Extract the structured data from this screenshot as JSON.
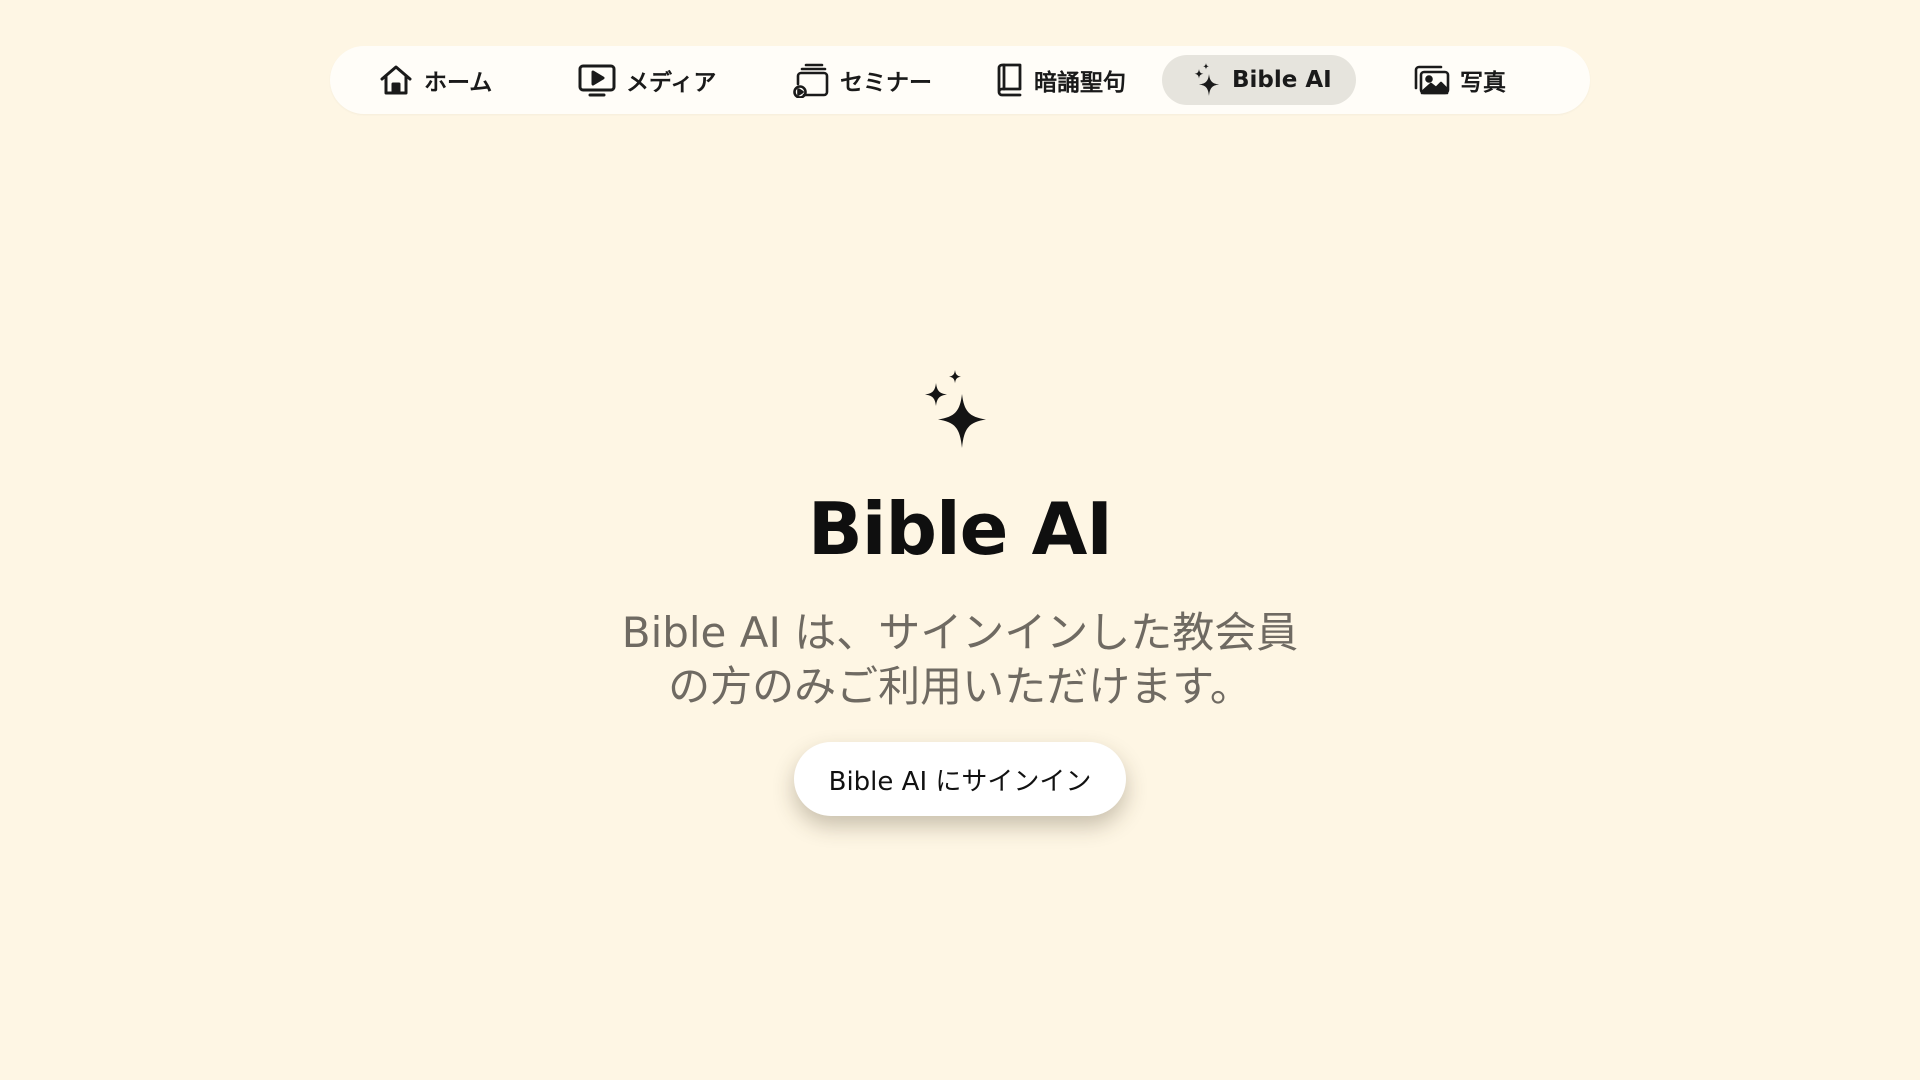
{
  "nav": {
    "items": [
      {
        "label": "ホーム",
        "icon": "home-icon"
      },
      {
        "label": "メディア",
        "icon": "play-screen-icon"
      },
      {
        "label": "セミナー",
        "icon": "seminar-stack-icon"
      },
      {
        "label": "暗誦聖句",
        "icon": "book-icon"
      },
      {
        "label": "Bible AI",
        "icon": "sparkles-icon",
        "active": true
      },
      {
        "label": "写真",
        "icon": "photos-icon"
      }
    ]
  },
  "hero": {
    "icon": "sparkles-icon",
    "title": "Bible AI",
    "description_line1": "Bible AI は、サインインした教会員",
    "description_line2": "の方のみご利用いただけます。",
    "signin_label": "Bible AI にサインイン"
  },
  "colors": {
    "background": "#fef6e4",
    "nav_background": "#fffdf8",
    "active_pill": "#e6e4dd",
    "description_text": "#6f6a62"
  }
}
